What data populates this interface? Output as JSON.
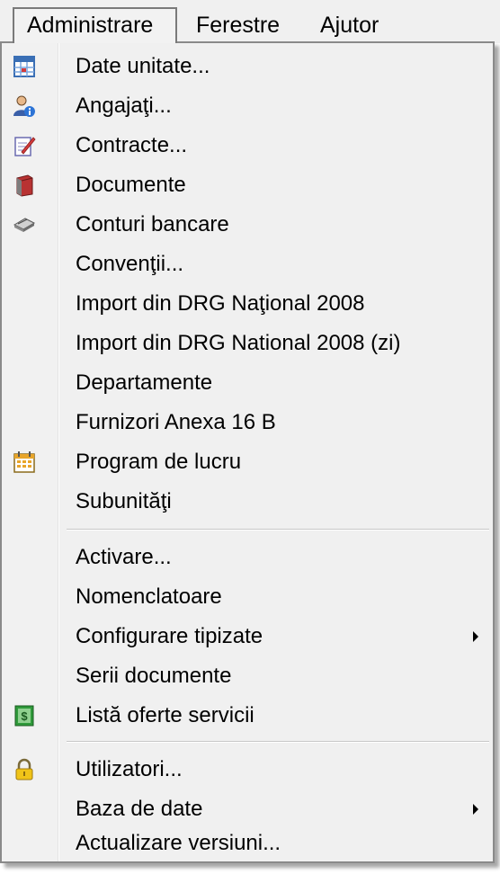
{
  "menubar": {
    "items": [
      {
        "label": "Administrare"
      },
      {
        "label": "Ferestre"
      },
      {
        "label": "Ajutor"
      }
    ]
  },
  "menu": {
    "items": [
      {
        "label": "Date unitate...",
        "icon": "calendar-grid-icon"
      },
      {
        "label": "Angajaţi...",
        "icon": "person-info-icon"
      },
      {
        "label": "Contracte...",
        "icon": "edit-document-icon"
      },
      {
        "label": "Documente",
        "icon": "book-icon"
      },
      {
        "label": "Conturi bancare",
        "icon": "card-icon"
      },
      {
        "label": "Convenţii..."
      },
      {
        "label": "Import din DRG Naţional 2008"
      },
      {
        "label": "Import din DRG National 2008 (zi)"
      },
      {
        "label": "Departamente"
      },
      {
        "label": "Furnizori Anexa 16 B"
      },
      {
        "label": "Program de lucru",
        "icon": "calendar-icon"
      },
      {
        "label": "Subunităţi"
      },
      {
        "label": "Activare..."
      },
      {
        "label": "Nomenclatoare"
      },
      {
        "label": "Configurare tipizate",
        "submenu": true
      },
      {
        "label": "Serii documente"
      },
      {
        "label": "Listă oferte servicii",
        "icon": "money-icon"
      },
      {
        "label": "Utilizatori...",
        "icon": "lock-icon"
      },
      {
        "label": "Baza de date",
        "submenu": true
      },
      {
        "label": "Actualizare versiuni..."
      }
    ]
  }
}
